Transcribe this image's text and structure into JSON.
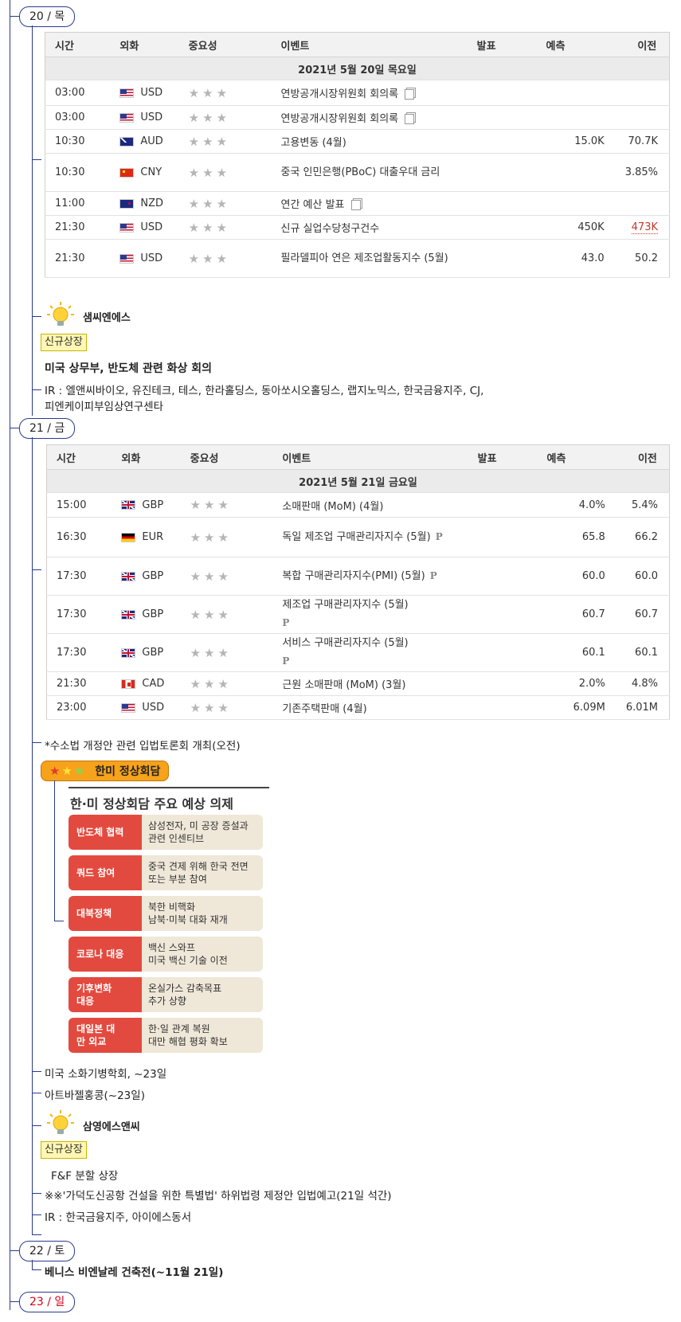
{
  "table_headers": {
    "time": "시간",
    "currency": "외화",
    "importance": "중요성",
    "event": "이벤트",
    "actual": "발표",
    "forecast": "예측",
    "previous": "이전"
  },
  "day20": {
    "tag": "20 / 목",
    "date_label": "2021년 5월 20일 목요일",
    "rows": [
      {
        "time": "03:00",
        "currency": "USD",
        "event": "연방공개시장위원회 회의록",
        "forecast": "",
        "previous": ""
      },
      {
        "time": "03:00",
        "currency": "USD",
        "event": "연방공개시장위원회 회의록",
        "forecast": "",
        "previous": ""
      },
      {
        "time": "10:30",
        "currency": "AUD",
        "event": "고용변동 (4월)",
        "forecast": "15.0K",
        "previous": "70.7K"
      },
      {
        "time": "10:30",
        "currency": "CNY",
        "event": "중국 인민은행(PBoC) 대출우대 금리",
        "forecast": "",
        "previous": "3.85%"
      },
      {
        "time": "11:00",
        "currency": "NZD",
        "event": "연간 예산 발표",
        "forecast": "",
        "previous": ""
      },
      {
        "time": "21:30",
        "currency": "USD",
        "event": "신규 실업수당청구건수",
        "forecast": "450K",
        "previous": "473K"
      },
      {
        "time": "21:30",
        "currency": "USD",
        "event": "필라델피아 연은 제조업활동지수 (5월)",
        "forecast": "43.0",
        "previous": "50.2"
      }
    ],
    "company": "샘씨엔에스",
    "new_listing": "신규상장",
    "note1": "미국 상무부, 반도체 관련 화상 회의",
    "ir_line1": "IR : 엘앤씨바이오, 유진테크, 테스, 한라홀딩스, 동아쏘시오홀딩스, 랩지노믹스, 한국금융지주, CJ,",
    "ir_line2": "피엔케이피부임상연구센타"
  },
  "day21": {
    "tag": "21 / 금",
    "date_label": "2021년 5월 21일 금요일",
    "rows": [
      {
        "time": "15:00",
        "currency": "GBP",
        "event": "소매판매 (MoM) (4월)",
        "forecast": "4.0%",
        "previous": "5.4%"
      },
      {
        "time": "16:30",
        "currency": "EUR",
        "event": "독일 제조업 구매관리자지수 (5월)",
        "forecast": "65.8",
        "previous": "66.2"
      },
      {
        "time": "17:30",
        "currency": "GBP",
        "event": "복합 구매관리자지수(PMI) (5월)",
        "forecast": "60.0",
        "previous": "60.0"
      },
      {
        "time": "17:30",
        "currency": "GBP",
        "event": "제조업 구매관리자지수 (5월)",
        "forecast": "60.7",
        "previous": "60.7"
      },
      {
        "time": "17:30",
        "currency": "GBP",
        "event": "서비스 구매관리자지수 (5월)",
        "forecast": "60.1",
        "previous": "60.1"
      },
      {
        "time": "21:30",
        "currency": "CAD",
        "event": "근원 소매판매 (MoM) (3월)",
        "forecast": "2.0%",
        "previous": "4.8%"
      },
      {
        "time": "23:00",
        "currency": "USD",
        "event": "기존주택판매 (4월)",
        "forecast": "6.09M",
        "previous": "6.01M"
      }
    ],
    "note_forum": "*수소법 개정안 관련 입법토론회 개최(오전)",
    "summit_label": "한미 정상회담",
    "agenda_title": "한·미 정상회담 주요 예상 의제",
    "agenda": [
      {
        "label": "반도체 협력",
        "desc": "삼성전자, 미 공장 증설과\n관련 인센티브"
      },
      {
        "label": "쿼드 참여",
        "desc": "중국 견제 위해 한국 전면\n또는 부분 참여"
      },
      {
        "label": "대북정책",
        "desc": "북한 비핵화\n남북·미북 대화 재개"
      },
      {
        "label": "코로나 대응",
        "desc": "백신 스와프\n미국 백신 기술 이전"
      },
      {
        "label": "기후변화 대응",
        "desc": "온실가스 감축목표\n추가 상향"
      },
      {
        "label": "대일본 대만 외교",
        "desc": "한·일 관계 복원\n대만 해협 평화 확보"
      }
    ],
    "note_gastro": "미국 소화기병학회, ~23일",
    "note_art": "아트바젤홍콩(~23일)",
    "company": "삼영에스앤씨",
    "new_listing": "신규상장",
    "note_ff": "F&F 분할 상장",
    "note_airport": "※※'가덕도신공항 건설을 위한 특별법' 하위법령 제정안 입법예고(21일 석간)",
    "ir": "IR : 한국금융지주, 아이에스동서"
  },
  "day22": {
    "tag": "22 / 토",
    "note": "베니스 비엔날레 건축전(~11월 21일)"
  },
  "day23": {
    "tag": "23 / 일"
  },
  "colors": {
    "line": "#2a3a8f",
    "sunday": "#d0021b",
    "badge_bg": "#fff7b3",
    "summit_bg": "#f7a21b",
    "agenda_red": "#e34a3f",
    "agenda_beige": "#efe7d8"
  }
}
